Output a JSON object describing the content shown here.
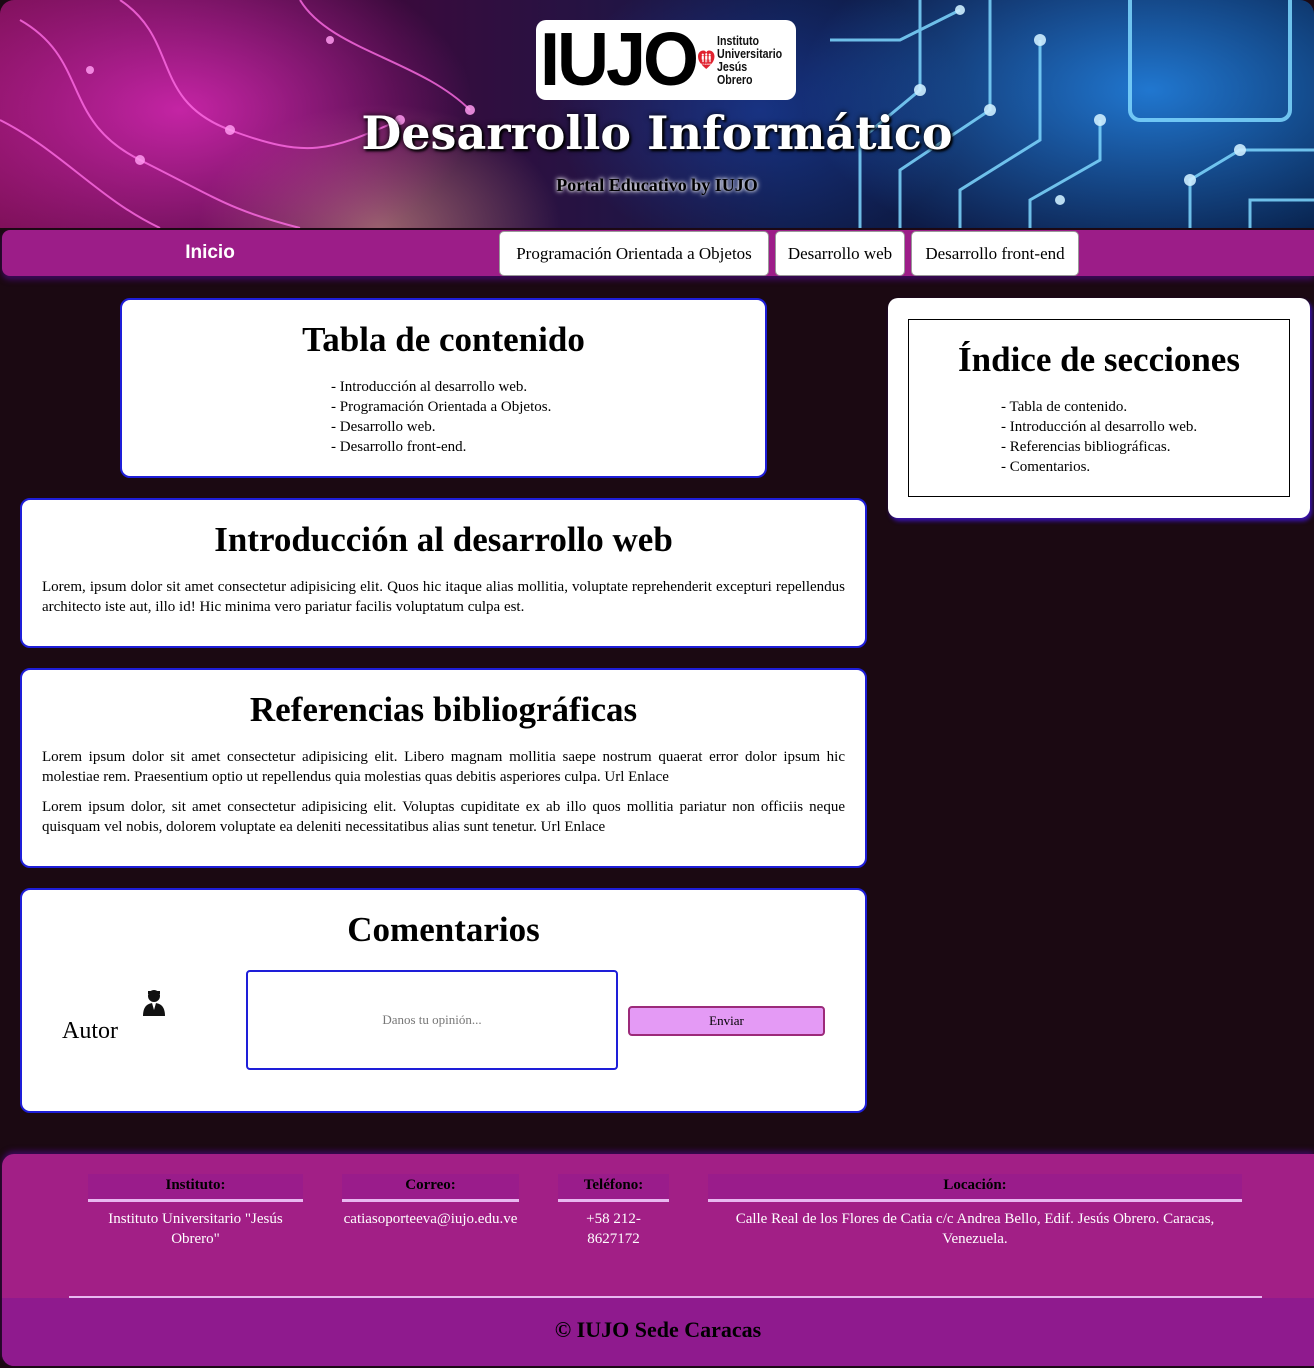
{
  "header": {
    "logo_text": "IUJO",
    "logo_heart_text": "FE Y ALEGRIA",
    "logo_subtitle_lines": [
      "Instituto",
      "Universitario",
      "Jesús",
      "Obrero"
    ],
    "title": "Desarrollo Informático",
    "subtitle": "Portal Educativo by IUJO"
  },
  "nav": {
    "home": "Inicio",
    "items": [
      {
        "label": "Programación Orientada a Objetos"
      },
      {
        "label": "Desarrollo web"
      },
      {
        "label": "Desarrollo front-end"
      }
    ]
  },
  "toc": {
    "title": "Tabla de contenido",
    "items": [
      "- Introducción al desarrollo web.",
      "- Programación Orientada a Objetos.",
      "- Desarrollo web.",
      "- Desarrollo front-end."
    ]
  },
  "sections_index": {
    "title": "Índice de secciones",
    "items": [
      "- Tabla de contenido.",
      "- Introducción al desarrollo web.",
      "- Referencias bibliográficas.",
      "- Comentarios."
    ]
  },
  "intro": {
    "title": "Introducción al desarrollo web",
    "text": "Lorem, ipsum dolor sit amet consectetur adipisicing elit. Quos hic itaque alias mollitia, voluptate reprehenderit excepturi repellendus architecto iste aut, illo id! Hic minima vero pariatur facilis voluptatum culpa est."
  },
  "references": {
    "title": "Referencias bibliográficas",
    "paragraphs": [
      "Lorem ipsum dolor sit amet consectetur adipisicing elit. Libero magnam mollitia saepe nostrum quaerat error dolor ipsum hic molestiae rem. Praesentium optio ut repellendus quia molestias quas debitis asperiores culpa. Url Enlace",
      "Lorem ipsum dolor, sit amet consectetur adipisicing elit. Voluptas cupiditate ex ab illo quos mollitia pariatur non officiis neque quisquam vel nobis, dolorem voluptate ea deleniti necessitatibus alias sunt tenetur. Url Enlace"
    ]
  },
  "comments": {
    "title": "Comentarios",
    "author_label": "Autor",
    "author_icon": "user-icon",
    "textarea_placeholder": "Danos tu opinión...",
    "submit_label": "Enviar"
  },
  "footer": {
    "columns": [
      {
        "heading": "Instituto:",
        "value": "Instituto Universitario \"Jesús Obrero\""
      },
      {
        "heading": "Correo:",
        "value": "catiasoporteeva@iujo.edu.ve"
      },
      {
        "heading": "Teléfono:",
        "value": "+58 212-8627172"
      },
      {
        "heading": "Locación:",
        "value": "Calle Real de los Flores de Catia c/c Andrea Bello, Edif. Jesús Obrero. Caracas, Venezuela."
      }
    ],
    "copyright": "© IUJO Sede Caracas"
  },
  "colors": {
    "background": "#1b0912",
    "nav": "#9c1d88",
    "footer": "#a21f86",
    "card_border": "#1e1ed8",
    "button": "#e49af5"
  }
}
